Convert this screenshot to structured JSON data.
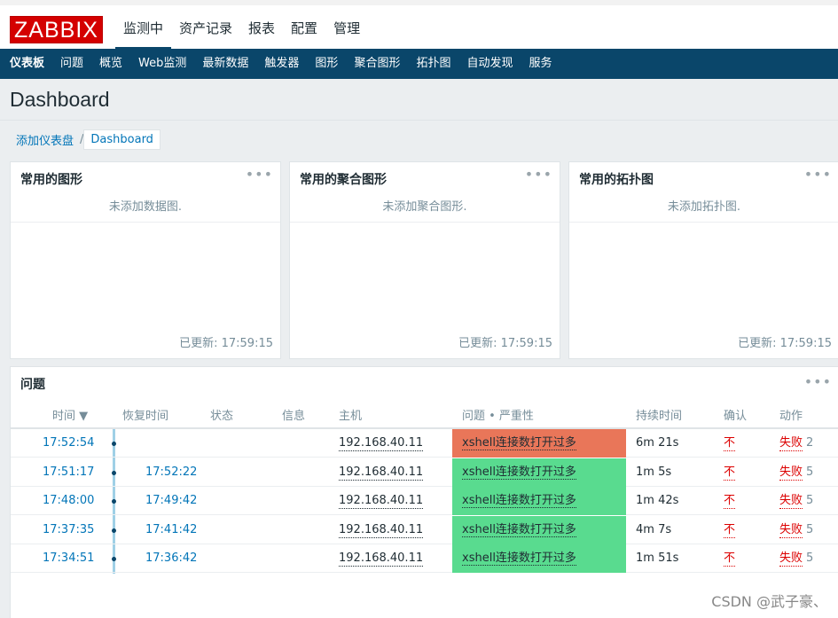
{
  "brand": {
    "logo": "ZABBIX"
  },
  "top_nav": [
    "监测中",
    "资产记录",
    "报表",
    "配置",
    "管理"
  ],
  "sub_nav": [
    "仪表板",
    "问题",
    "概览",
    "Web监测",
    "最新数据",
    "触发器",
    "图形",
    "聚合图形",
    "拓扑图",
    "自动发现",
    "服务"
  ],
  "page": {
    "title": "Dashboard"
  },
  "breadcrumb": {
    "add": "添加仪表盘",
    "sep": "/",
    "current": "Dashboard"
  },
  "widgets": [
    {
      "title": "常用的图形",
      "empty": "未添加数据图.",
      "updated": "已更新: 17:59:15",
      "menu": "•••"
    },
    {
      "title": "常用的聚合图形",
      "empty": "未添加聚合图形.",
      "updated": "已更新: 17:59:15",
      "menu": "•••"
    },
    {
      "title": "常用的拓扑图",
      "empty": "未添加拓扑图.",
      "updated": "已更新: 17:59:15",
      "menu": "•••"
    }
  ],
  "problems": {
    "title": "问题",
    "menu": "•••",
    "columns": {
      "time": "时间 ▼",
      "recovery": "恢复时间",
      "status": "状态",
      "info": "信息",
      "host": "主机",
      "problem": "问题 • 严重性",
      "duration": "持续时间",
      "ack": "确认",
      "actions": "动作"
    },
    "rows": [
      {
        "time": "17:52:54",
        "recovery": "",
        "host": "192.168.40.11",
        "problem": "xshell连接数打开过多",
        "severity_color": "#e97659",
        "duration": "6m 21s",
        "ack": "不",
        "action": "失败",
        "count": "2"
      },
      {
        "time": "17:51:17",
        "recovery": "17:52:22",
        "host": "192.168.40.11",
        "problem": "xshell连接数打开过多",
        "severity_color": "#59db8f",
        "duration": "1m 5s",
        "ack": "不",
        "action": "失败",
        "count": "5"
      },
      {
        "time": "17:48:00",
        "recovery": "17:49:42",
        "host": "192.168.40.11",
        "problem": "xshell连接数打开过多",
        "severity_color": "#59db8f",
        "duration": "1m 42s",
        "ack": "不",
        "action": "失败",
        "count": "5"
      },
      {
        "time": "17:37:35",
        "recovery": "17:41:42",
        "host": "192.168.40.11",
        "problem": "xshell连接数打开过多",
        "severity_color": "#59db8f",
        "duration": "4m 7s",
        "ack": "不",
        "action": "失败",
        "count": "5"
      },
      {
        "time": "17:34:51",
        "recovery": "17:36:42",
        "host": "192.168.40.11",
        "problem": "xshell连接数打开过多",
        "severity_color": "#59db8f",
        "duration": "1m 51s",
        "ack": "不",
        "action": "失败",
        "count": "5"
      }
    ]
  },
  "watermark": "CSDN @武子豪、"
}
